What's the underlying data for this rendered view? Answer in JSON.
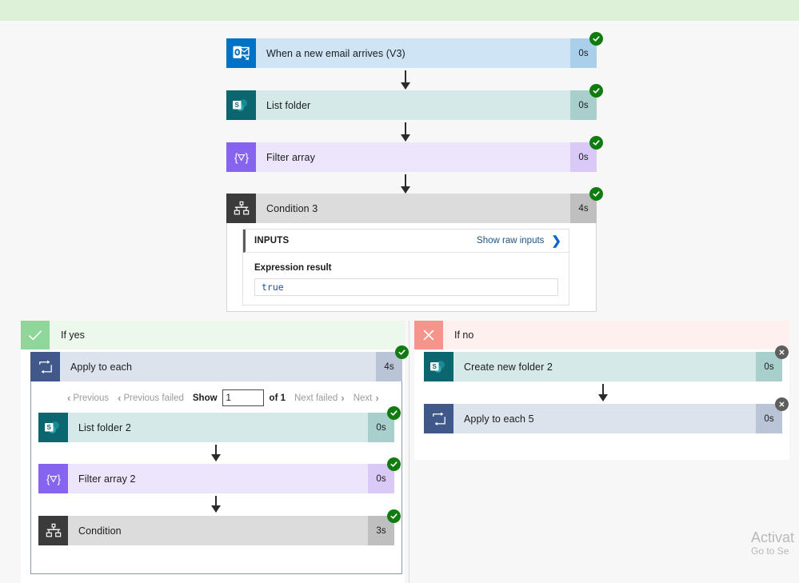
{
  "banner": {
    "color": "#ddf0d8"
  },
  "flow": {
    "steps": [
      {
        "name": "When a new email arrives (V3)",
        "duration": "0s",
        "status": "ok",
        "icon": "outlook-icon",
        "tile_color": "#0072c6",
        "body_color": "#cfe4f5",
        "dur_color": "#a9cfeb"
      },
      {
        "name": "List folder",
        "duration": "0s",
        "status": "ok",
        "icon": "sharepoint-icon",
        "tile_color": "#0c6670",
        "body_color": "#d4e9e8",
        "dur_color": "#a9cfcd"
      },
      {
        "name": "Filter array",
        "duration": "0s",
        "status": "ok",
        "icon": "filter-array-icon",
        "tile_color": "#8764f0",
        "body_color": "#ece5fb",
        "dur_color": "#d9c9f7"
      },
      {
        "name": "Condition 3",
        "duration": "4s",
        "status": "ok",
        "icon": "condition-icon",
        "tile_color": "#3b3b3b",
        "body_color": "#dcdcdc",
        "dur_color": "#bfbfbf"
      }
    ]
  },
  "inputs_panel": {
    "section_label": "INPUTS",
    "show_raw_link": "Show raw inputs",
    "chevron": "❯",
    "field_label": "Expression result",
    "value": "true"
  },
  "branch_yes": {
    "label": "If yes",
    "mark": "check-icon",
    "scope": {
      "name": "Apply to each",
      "duration": "4s",
      "status": "ok",
      "icon": "apply-to-each-icon",
      "tile_color": "#41598a",
      "body_color": "#dde3ed",
      "dur_color": "#b9c4d6"
    },
    "pager": {
      "previous": "Previous",
      "previous_failed": "Previous failed",
      "show": "Show",
      "value": "1",
      "of": "of 1",
      "next_failed": "Next failed",
      "next": "Next",
      "chevron_left": "‹",
      "chevron_right": "›"
    },
    "steps": [
      {
        "name": "List folder 2",
        "duration": "0s",
        "status": "ok",
        "icon": "sharepoint-icon",
        "tile_color": "#0c6670",
        "body_color": "#d4e9e8",
        "dur_color": "#a9cfcd"
      },
      {
        "name": "Filter array 2",
        "duration": "0s",
        "status": "ok",
        "icon": "filter-array-icon",
        "tile_color": "#8764f0",
        "body_color": "#ece5fb",
        "dur_color": "#d9c9f7"
      },
      {
        "name": "Condition",
        "duration": "3s",
        "status": "ok",
        "icon": "condition-icon",
        "tile_color": "#3b3b3b",
        "body_color": "#dcdcdc",
        "dur_color": "#bfbfbf"
      }
    ]
  },
  "branch_no": {
    "label": "If no",
    "mark": "close-icon",
    "steps": [
      {
        "name": "Create new folder 2",
        "duration": "0s",
        "status": "skip",
        "icon": "sharepoint-icon",
        "tile_color": "#0c6670",
        "body_color": "#d4e9e8",
        "dur_color": "#a9cfcd"
      },
      {
        "name": "Apply to each 5",
        "duration": "0s",
        "status": "skip",
        "icon": "apply-to-each-icon",
        "tile_color": "#41598a",
        "body_color": "#dde3ed",
        "dur_color": "#b9c4d6"
      }
    ]
  },
  "watermark": {
    "line1": "Activat",
    "line2": "Go to Se"
  },
  "colors": {
    "status_ok": "#107c10",
    "status_skip": "#5e5e5e",
    "link": "#0b63ce"
  }
}
